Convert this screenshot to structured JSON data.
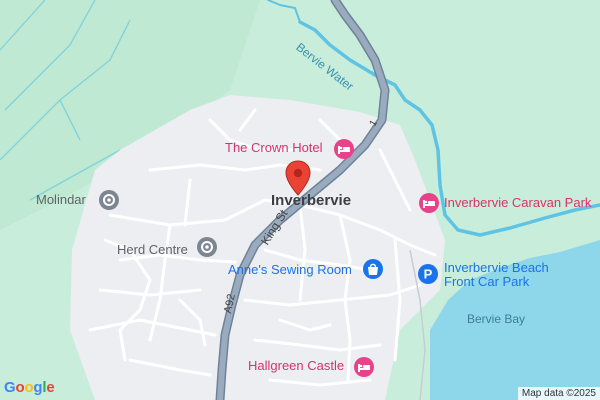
{
  "map": {
    "town": "Inverbervie",
    "pois": {
      "crown_hotel": "The Crown Hotel",
      "caravan_park": "Inverbervie Caravan Park",
      "sewing_room": "Anne's Sewing Room",
      "herd_centre": "Herd Centre",
      "molindar": "Molindar",
      "beach_car_park_line1": "Inverbervie Beach",
      "beach_car_park_line2": "Front Car Park",
      "hallgreen_castle": "Hallgreen Castle"
    },
    "water": {
      "river": "Bervie Water",
      "bay": "Bervie Bay"
    },
    "roads": {
      "a92": "A92",
      "king_st": "King St",
      "route_1": "1"
    },
    "attribution": "Map data ©2025",
    "logo": "Google",
    "colors": {
      "land": "#c8eedb",
      "urban": "#eceef1",
      "water": "#8ed6ea",
      "river": "#5fc3e4",
      "main_road": "#8a9bb0",
      "poi_pink": "#e8438a",
      "poi_gray": "#7c8692",
      "poi_blue": "#1a73e8",
      "pin_red": "#ea4335"
    }
  }
}
